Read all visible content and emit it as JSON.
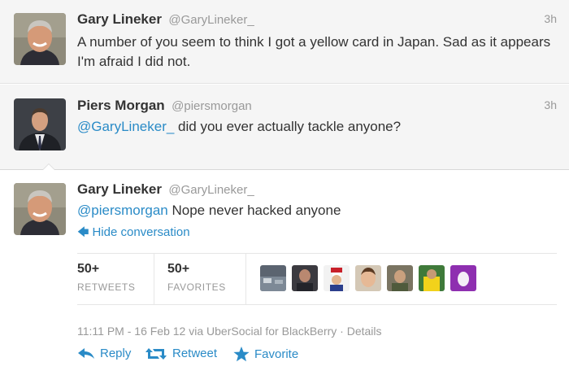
{
  "tweets": [
    {
      "fullname": "Gary Lineker",
      "username": "@GaryLineker_",
      "time": "3h",
      "text": "A number of you seem to think I got a yellow card in Japan. Sad as it appears I'm afraid I did not."
    },
    {
      "fullname": "Piers Morgan",
      "username": "@piersmorgan",
      "time": "3h",
      "mention": "@GaryLineker_",
      "text": " did you ever actually tackle anyone?"
    },
    {
      "fullname": "Gary Lineker",
      "username": "@GaryLineker_",
      "mention": "@piersmorgan",
      "text": " Nope never hacked anyone",
      "hide_conversation": "Hide conversation",
      "retweets_count": "50+",
      "retweets_label": "RETWEETS",
      "favorites_count": "50+",
      "favorites_label": "FAVORITES",
      "meta": "11:11 PM - 16 Feb 12 via UberSocial for BlackBerry · Details",
      "actions": {
        "reply": "Reply",
        "retweet": "Retweet",
        "favorite": "Favorite"
      }
    }
  ],
  "icons": {
    "reply": "reply-arrow-icon",
    "retweet": "retweet-icon",
    "favorite": "star-icon"
  },
  "colors": {
    "link": "#2a8bc7",
    "muted": "#999999",
    "text": "#333333",
    "gray_background": "#f5f5f5"
  }
}
